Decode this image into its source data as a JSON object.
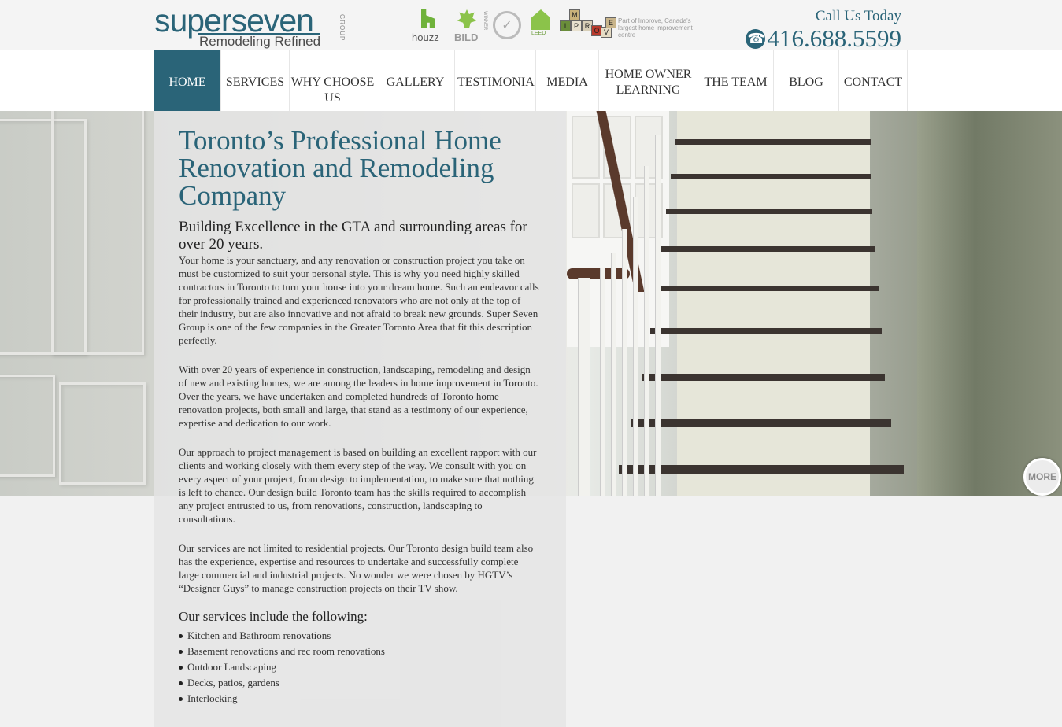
{
  "header": {
    "logo": {
      "word_a": "super",
      "word_b": "seven",
      "tagline": "Remodeling Refined",
      "group": "GROUP"
    },
    "badges": {
      "houzz": "houzz",
      "bild": "BILD",
      "bild_winner": "WINNER",
      "leed": "LEED",
      "improve_blocks": [
        "I",
        "M",
        "P",
        "R",
        "O",
        "V",
        "E"
      ],
      "improve_note": "Part of Improve, Canada's largest home improvement centre"
    },
    "call_label": "Call Us Today",
    "phone": "416.688.5599"
  },
  "nav": {
    "items": [
      {
        "label": "HOME",
        "active": true
      },
      {
        "label": "SERVICES"
      },
      {
        "label": "WHY CHOOSE US"
      },
      {
        "label": "GALLERY"
      },
      {
        "label": "TESTIMONIALS"
      },
      {
        "label": "MEDIA"
      },
      {
        "label": "HOME OWNER LEARNING"
      },
      {
        "label": "THE TEAM"
      },
      {
        "label": "BLOG"
      },
      {
        "label": "CONTACT"
      }
    ]
  },
  "hero": {
    "more_label": "MORE"
  },
  "content": {
    "title": "Toronto’s Professional Home Renovation and Remodeling Company",
    "subtitle": "Building Excellence in the GTA and surrounding areas for over 20 years.",
    "paragraphs": [
      "Your home is your sanctuary, and any renovation or construction project you take on must be customized to suit your personal style. This is why you need highly skilled contractors in Toronto to turn your house into your dream home. Such an endeavor calls for professionally trained and experienced renovators who are not only at the top of their industry, but are also innovative and not afraid to break new grounds. Super Seven Group is one of the few companies in the Greater Toronto Area that fit this description perfectly.",
      "With over 20 years of experience in construction, landscaping, remodeling and design of new and existing homes, we are among the leaders in home improvement in Toronto. Over the years, we have undertaken and completed hundreds of Toronto home renovation projects, both small and large, that stand as a testimony of our experience, expertise and dedication to our work.",
      "Our approach to project management is based on building an excellent rapport with our clients and working closely with them every step of the way. We consult with you on every aspect of your project, from design to implementation, to make sure that nothing is left to chance. Our design build Toronto team has the skills required to accomplish any project entrusted to us, from renovations, construction, landscaping to consultations.",
      "Our services are not limited to residential projects. Our Toronto design build team also has the experience, expertise and resources to undertake and successfully complete large commercial and industrial projects. No wonder we were chosen by HGTV’s “Designer Guys” to manage construction projects on their TV show."
    ],
    "services_heading": "Our services include the following:",
    "services": [
      "Kitchen and Bathroom renovations",
      "Basement renovations and rec room renovations",
      "Outdoor Landscaping",
      "Decks, patios, gardens",
      "Interlocking"
    ]
  }
}
